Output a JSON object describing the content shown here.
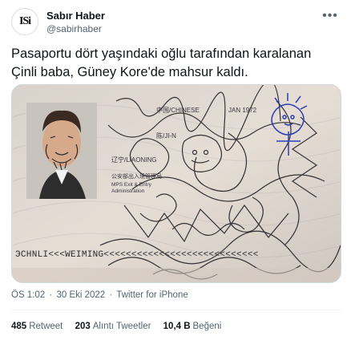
{
  "account": {
    "display_name": "Sabır Haber",
    "handle": "@sabirhaber",
    "avatar_text": "ISi"
  },
  "tweet": {
    "line1": "Pasaportu dört yaşındaki oğlu tarafından karalanan",
    "line2": "Çinli baba, Güney Kore'de mahsur kaldı."
  },
  "media": {
    "icon": "passport-photo",
    "passport_text": {
      "country": "中国/CHINESE",
      "date": "JAN 1972",
      "name": "陈/JI-N",
      "province": "辽宁/LIAONING",
      "authority_line1": "公安部出入境管理局",
      "authority_line2": "MPS Exit & Entry",
      "authority_line3": "Administration",
      "mrz": "ЭCHNLI<<<WEIMING<<<<<<<<<<<<<<<<<<<<<<<<<<<<"
    }
  },
  "meta": {
    "time": "ÖS 1:02",
    "separator": "·",
    "date": "30 Eki 2022",
    "source": "Twitter for iPhone"
  },
  "stats": {
    "retweets_count": "485",
    "retweets_label": "Retweet",
    "quotes_count": "203",
    "quotes_label": "Alıntı Tweetler",
    "likes_count": "10,4 B",
    "likes_label": "Beğeni"
  },
  "more_icon": "more-horizontal-icon"
}
